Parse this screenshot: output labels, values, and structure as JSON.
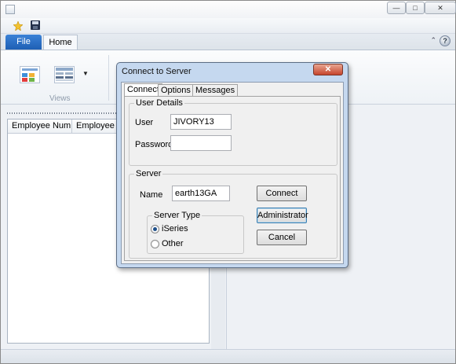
{
  "window": {
    "title": "",
    "controls": {
      "minimize": "—",
      "maximize": "□",
      "close": "✕"
    }
  },
  "quick_access": {
    "new_icon": "new-file-icon",
    "save_icon": "save-icon"
  },
  "ribbon": {
    "tabs": [
      {
        "label": "File"
      },
      {
        "label": "Home"
      }
    ],
    "minimize_glyph": "⌃",
    "help_glyph": "?",
    "group_label": "Views",
    "dropdown_glyph": "▼"
  },
  "grid": {
    "columns": [
      "Employee Num...",
      "Employee Su"
    ]
  },
  "dialog": {
    "title": "Connect to Server",
    "close_glyph": "✕",
    "tabs": [
      "Connect",
      "Options",
      "Messages"
    ],
    "user_details": {
      "title": "User Details",
      "user_label": "User",
      "user_value": "JIVORY13",
      "password_label": "Password",
      "password_value": ""
    },
    "server": {
      "title": "Server",
      "name_label": "Name",
      "name_value": "earth13GA",
      "server_type_title": "Server Type",
      "options": [
        {
          "label": "iSeries",
          "selected": true
        },
        {
          "label": "Other",
          "selected": false
        }
      ]
    },
    "buttons": {
      "connect": "Connect",
      "administrator": "Administrator",
      "cancel": "Cancel"
    }
  },
  "colors": {
    "file_tab": "#2a6fc4",
    "dialog_frame": "#c5d8ef",
    "close_button": "#c6442c"
  }
}
